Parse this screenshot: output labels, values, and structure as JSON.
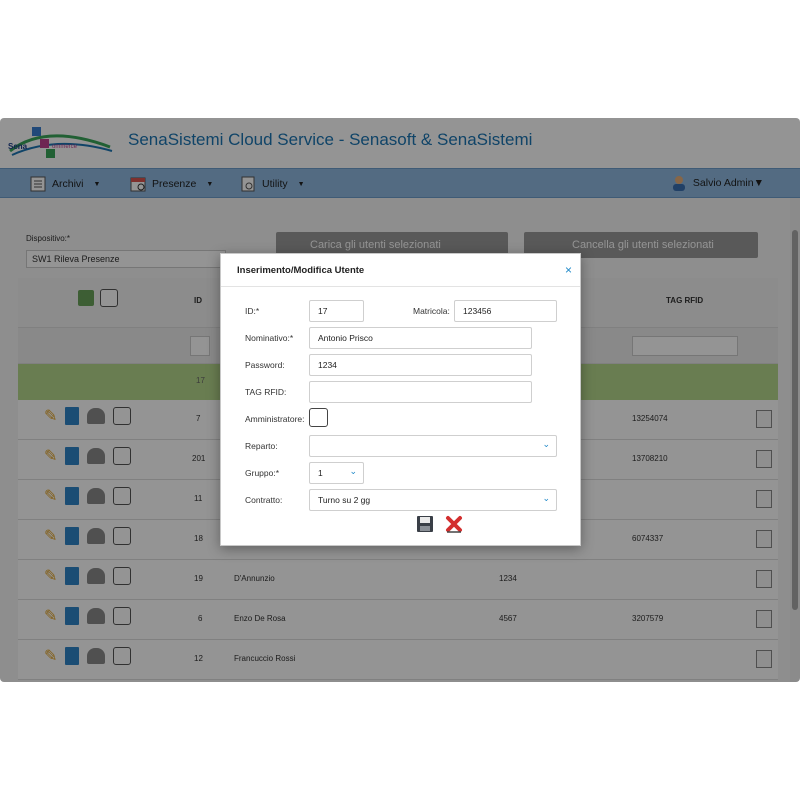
{
  "app": {
    "title": "SenaSistemi Cloud Service - Senasoft & SenaSistemi",
    "logo_text": "Sena Commerce",
    "brand_colors": {
      "accent": "#1d76b3",
      "navbar": "#8fb9e0"
    }
  },
  "navbar": {
    "items": [
      {
        "label": "Archivi",
        "icon": "archive-icon"
      },
      {
        "label": "Presenze",
        "icon": "calendar-icon"
      },
      {
        "label": "Utility",
        "icon": "utility-icon"
      }
    ],
    "user": {
      "label": "Salvio Admin",
      "icon": "user-avatar-icon"
    }
  },
  "filters": {
    "device_label": "Dispositivo:*",
    "device_value": "SW1 Rileva Presenze",
    "load_button": "Carica gli utenti selezionati",
    "delete_button": "Cancella gli utenti selezionati"
  },
  "table": {
    "headers": {
      "id": "ID",
      "rfid": "TAG RFID"
    },
    "selected_row_id": "17",
    "rows": [
      {
        "id": "7",
        "name": "",
        "matricola": "",
        "rfid": "13254074"
      },
      {
        "id": "201",
        "name": "",
        "matricola": "",
        "rfid": "13708210"
      },
      {
        "id": "11",
        "name": "",
        "matricola": "",
        "rfid": ""
      },
      {
        "id": "18",
        "name": "",
        "matricola": "",
        "rfid": "6074337"
      },
      {
        "id": "19",
        "name": "D'Annunzio",
        "matricola": "1234",
        "rfid": ""
      },
      {
        "id": "6",
        "name": "Enzo De Rosa",
        "matricola": "4567",
        "rfid": "3207579"
      },
      {
        "id": "12",
        "name": "Francuccio Rossi",
        "matricola": "",
        "rfid": ""
      }
    ]
  },
  "modal": {
    "title": "Inserimento/Modifica Utente",
    "close": "×",
    "fields": {
      "id_label": "ID:*",
      "id_value": "17",
      "matricola_label": "Matricola:",
      "matricola_value": "123456",
      "nominativo_label": "Nominativo:*",
      "nominativo_value": "Antonio Prisco",
      "password_label": "Password:",
      "password_value": "1234",
      "rfid_label": "TAG RFID:",
      "rfid_value": "",
      "admin_label": "Amministratore:",
      "reparto_label": "Reparto:",
      "reparto_value": "",
      "gruppo_label": "Gruppo:*",
      "gruppo_value": "1",
      "contratto_label": "Contratto:",
      "contratto_value": "Turno su 2 gg"
    }
  }
}
